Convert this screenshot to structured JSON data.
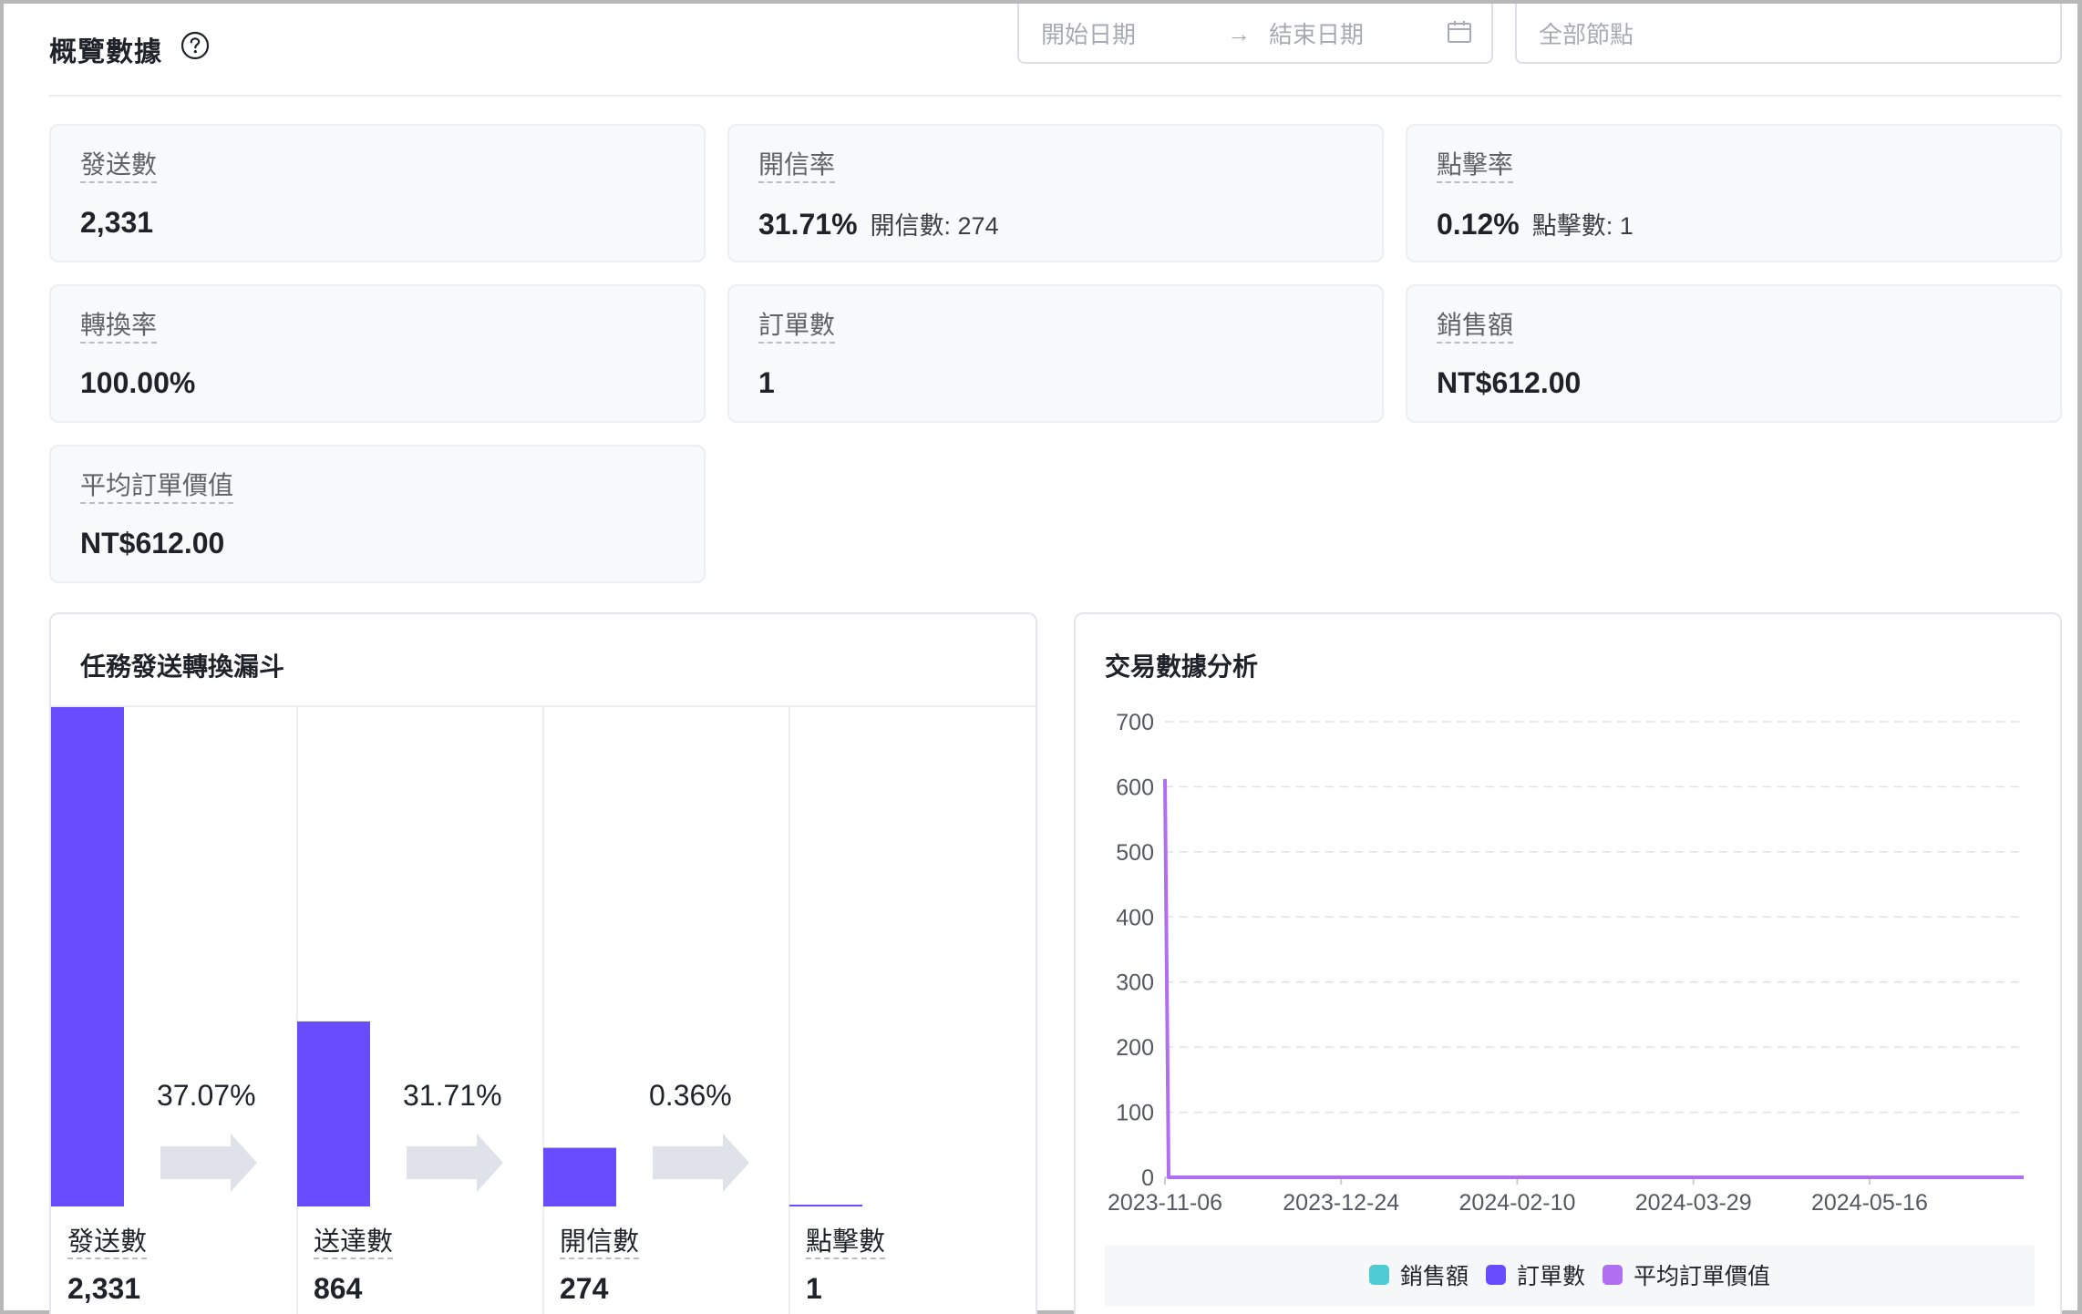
{
  "header": {
    "title": "概覽數據",
    "help_icon": "question-circle-icon",
    "date_range": {
      "start_placeholder": "開始日期",
      "separator": "→",
      "end_placeholder": "結束日期",
      "icon": "calendar-icon"
    },
    "node_select": {
      "placeholder": "全部節點"
    }
  },
  "stats": [
    {
      "label": "發送數",
      "value": "2,331"
    },
    {
      "label": "開信率",
      "value": "31.71%",
      "sub": "開信數: 274"
    },
    {
      "label": "點擊率",
      "value": "0.12%",
      "sub": "點擊數: 1"
    },
    {
      "label": "轉換率",
      "value": "100.00%"
    },
    {
      "label": "訂單數",
      "value": "1"
    },
    {
      "label": "銷售額",
      "value": "NT$612.00"
    },
    {
      "label": "平均訂單價值",
      "value": "NT$612.00"
    }
  ],
  "funnel": {
    "title": "任務發送轉換漏斗",
    "stages": [
      {
        "label": "發送數",
        "value": "2,331",
        "count": 2331
      },
      {
        "label": "送達數",
        "value": "864",
        "count": 864
      },
      {
        "label": "開信數",
        "value": "274",
        "count": 274
      },
      {
        "label": "點擊數",
        "value": "1",
        "count": 1
      }
    ],
    "rates": [
      "37.07%",
      "31.71%",
      "0.36%"
    ],
    "colors": {
      "bar": "#6a4cff",
      "arrow": "#dfe2e8"
    }
  },
  "chart_data": {
    "type": "line",
    "title": "交易數據分析",
    "ylim": [
      0,
      700
    ],
    "yticks": [
      0,
      100,
      200,
      300,
      400,
      500,
      600,
      700
    ],
    "xlim": [
      "2023-11-06",
      "2024-06-27"
    ],
    "xticks": [
      "2023-11-06",
      "2023-12-24",
      "2024-02-10",
      "2024-03-29",
      "2024-05-16"
    ],
    "grid": true,
    "legend_position": "bottom",
    "series": [
      {
        "name": "銷售額",
        "color": "#4ecbd3",
        "points": []
      },
      {
        "name": "訂單數",
        "color": "#6a4cff",
        "points": []
      },
      {
        "name": "平均訂單價值",
        "color": "#b06ef0",
        "points": [
          [
            "2023-11-06",
            612
          ],
          [
            "2023-11-07",
            0
          ],
          [
            "2024-06-27",
            0
          ]
        ]
      }
    ]
  }
}
